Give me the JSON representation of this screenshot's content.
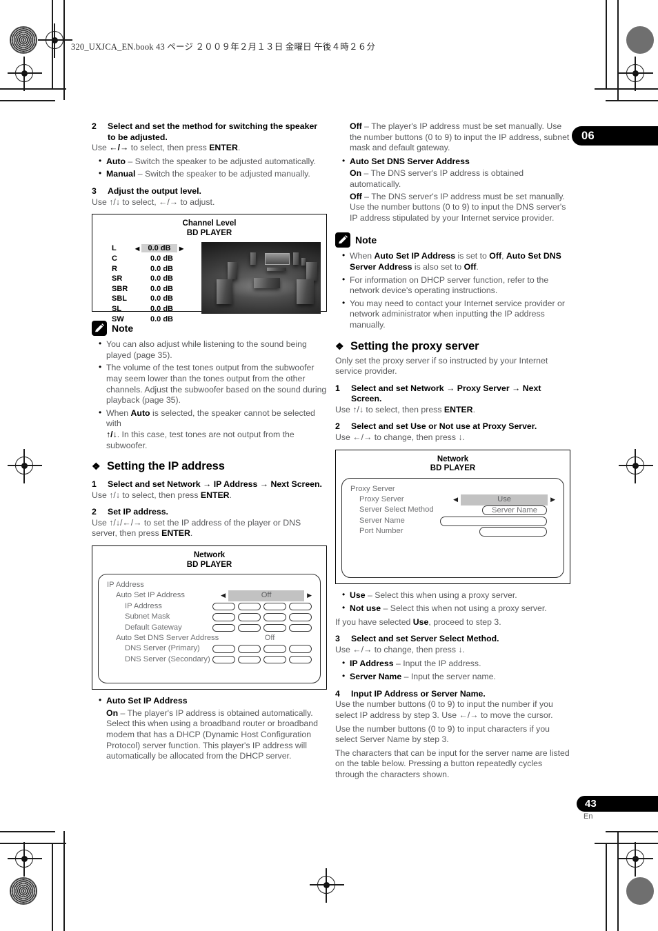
{
  "header": {
    "book_line": "320_UXJCA_EN.book   43 ページ   ２００９年２月１３日   金曜日   午後４時２６分"
  },
  "tabs": {
    "chapter": "06",
    "page_number": "43",
    "language": "En"
  },
  "left_column": {
    "step2": {
      "num": "2",
      "title": "Select and set the method for switching the speaker to be adjusted.",
      "instruction_pre": "Use ",
      "instruction_keys": "←/→",
      "instruction_mid": " to select, then press ",
      "instruction_key2": "ENTER",
      "instruction_end": ".",
      "bullets": [
        {
          "term": "Auto",
          "desc": " – Switch the speaker to be adjusted automatically."
        },
        {
          "term": "Manual",
          "desc": " – Switch the speaker to be adjusted manually."
        }
      ]
    },
    "step3": {
      "num": "3",
      "title": "Adjust the output level.",
      "instruction": "Use ↑/↓ to select, ←/→ to adjust."
    },
    "channel_level_osd": {
      "title": "Channel Level",
      "subtitle": "BD PLAYER",
      "rows": [
        {
          "name": "L",
          "value": "0.0 dB",
          "selected": true
        },
        {
          "name": "C",
          "value": "0.0 dB",
          "selected": false
        },
        {
          "name": "R",
          "value": "0.0 dB",
          "selected": false
        },
        {
          "name": "SR",
          "value": "0.0 dB",
          "selected": false
        },
        {
          "name": "SBR",
          "value": "0.0 dB",
          "selected": false
        },
        {
          "name": "SBL",
          "value": "0.0 dB",
          "selected": false
        },
        {
          "name": "SL",
          "value": "0.0 dB",
          "selected": false
        },
        {
          "name": "SW",
          "value": "0.0 dB",
          "selected": false
        }
      ]
    },
    "note": {
      "title": "Note",
      "items": [
        "You can also adjust while listening to the sound being played (page 35).",
        "The volume of the test tones output from the subwoofer may seem lower than the tones output from the other channels. Adjust the subwoofer based on the sound during playback (page 35).",
        "When Auto is selected, the speaker cannot be selected with ↑/↓. In this case, test tones are not output from the subwoofer."
      ],
      "item3_pre": "When ",
      "item3_bold": "Auto",
      "item3_mid": " is selected, the speaker cannot be selected with",
      "item3_keys": "↑/↓",
      "item3_end": ". In this case, test tones are not output from the subwoofer."
    },
    "section": {
      "title": "Setting the IP address",
      "deco": "❖"
    },
    "step1": {
      "num": "1",
      "title": "Select and set Network → IP Address → Next Screen.",
      "instruction": "Use ↑/↓ to select, then press ENTER.",
      "instruction_pre": "Use ↑/↓ to select, then press ",
      "instruction_bold": "ENTER",
      "instruction_end": "."
    },
    "step2b": {
      "num": "2",
      "title": "Set IP address.",
      "instruction_pre": "Use ↑/↓/←/→ to set the IP address of the player or DNS server, then press ",
      "instruction_bold": "ENTER",
      "instruction_end": "."
    },
    "network_osd": {
      "title": "Network",
      "subtitle": "BD PLAYER",
      "group": "IP Address",
      "rows": [
        {
          "label": "Auto Set IP Address",
          "indent": 1,
          "control": "select",
          "value": "Off"
        },
        {
          "label": "IP Address",
          "indent": 2,
          "control": "cells",
          "value": ""
        },
        {
          "label": "Subnet Mask",
          "indent": 2,
          "control": "cells",
          "value": ""
        },
        {
          "label": "Default Gateway",
          "indent": 2,
          "control": "cells",
          "value": ""
        },
        {
          "label": "Auto Set DNS Server Address",
          "indent": 1,
          "control": "plain",
          "value": "Off"
        },
        {
          "label": "DNS Server (Primary)",
          "indent": 2,
          "control": "cells",
          "value": ""
        },
        {
          "label": "DNS Server (Secondary)",
          "indent": 2,
          "control": "cells",
          "value": ""
        }
      ]
    },
    "auto_set_ip": {
      "term": "Auto Set IP Address",
      "on_bold": "On",
      "on_desc": " – The player's IP address is obtained automatically. Select this when using a broadband router or broadband modem that has a DHCP (Dynamic Host Configuration Protocol) server function. This player's IP address will automatically be allocated from the DHCP server."
    }
  },
  "right_column": {
    "off_ip": {
      "bold": "Off",
      "desc": " – The player's IP address must be set manually. Use the number buttons (0 to 9) to input the IP address, subnet mask and default gateway."
    },
    "auto_set_dns": {
      "term": "Auto Set DNS Server Address",
      "on_bold": "On",
      "on_desc": " – The DNS server's IP address is obtained automatically.",
      "off_bold": "Off",
      "off_desc": " – The DNS server's IP address must be set manually. Use the number buttons (0 to 9) to input the DNS server's IP address stipulated by your Internet service provider."
    },
    "note": {
      "title": "Note",
      "item1_pre": "When ",
      "item1_b1": "Auto Set IP Address",
      "item1_mid1": " is set to ",
      "item1_b2": "Off",
      "item1_mid2": ", ",
      "item1_b3": "Auto Set DNS Server Address",
      "item1_mid3": " is also set to ",
      "item1_b4": "Off",
      "item1_end": ".",
      "item2": "For information on DHCP server function, refer to the network device's operating instructions.",
      "item3": "You may need to contact your Internet service provider or network administrator when inputting the IP address manually."
    },
    "section": {
      "title": "Setting the proxy server",
      "deco": "❖",
      "intro": "Only set the proxy server if so instructed by your Internet service provider."
    },
    "step1": {
      "num": "1",
      "title": "Select and set Network → Proxy Server → Next Screen.",
      "instruction_pre": "Use ↑/↓ to select, then press ",
      "instruction_bold": "ENTER",
      "instruction_end": "."
    },
    "step2": {
      "num": "2",
      "title": "Select and set Use or Not use at Proxy Server.",
      "instruction": "Use ←/→ to change, then press ↓."
    },
    "proxy_osd": {
      "title": "Network",
      "subtitle": "BD PLAYER",
      "group": "Proxy Server",
      "rows": [
        {
          "label": "Proxy Server",
          "control": "select",
          "value": "Use"
        },
        {
          "label": "Server Select Method",
          "control": "button",
          "value": "Server Name"
        },
        {
          "label": "Server Name",
          "control": "wide",
          "value": ""
        },
        {
          "label": "Port Number",
          "control": "narrow",
          "value": ""
        }
      ]
    },
    "use_bullets": [
      {
        "term": "Use",
        "desc": " – Select this when using a proxy server."
      },
      {
        "term": "Not use",
        "desc": " – Select this when not using a proxy server."
      }
    ],
    "proceed_pre": "If you have selected ",
    "proceed_bold": "Use",
    "proceed_end": ", proceed to step 3.",
    "step3": {
      "num": "3",
      "title": "Select and set Server Select Method.",
      "instruction": "Use ←/→ to change, then press ↓.",
      "bullets": [
        {
          "term": "IP Address",
          "desc": " – Input the IP address."
        },
        {
          "term": "Server Name",
          "desc": " – Input the server name."
        }
      ]
    },
    "step4": {
      "num": "4",
      "title": "Input IP Address or Server Name.",
      "para1": "Use the number buttons (0 to 9) to input the number if you select IP address by step 3. Use ←/→ to move the cursor.",
      "para2": "Use the number buttons (0 to 9) to input characters if you select Server Name by step 3.",
      "para3": "The characters that can be input for the server name are listed on the table below. Pressing a button repeatedly cycles through the characters shown."
    }
  }
}
